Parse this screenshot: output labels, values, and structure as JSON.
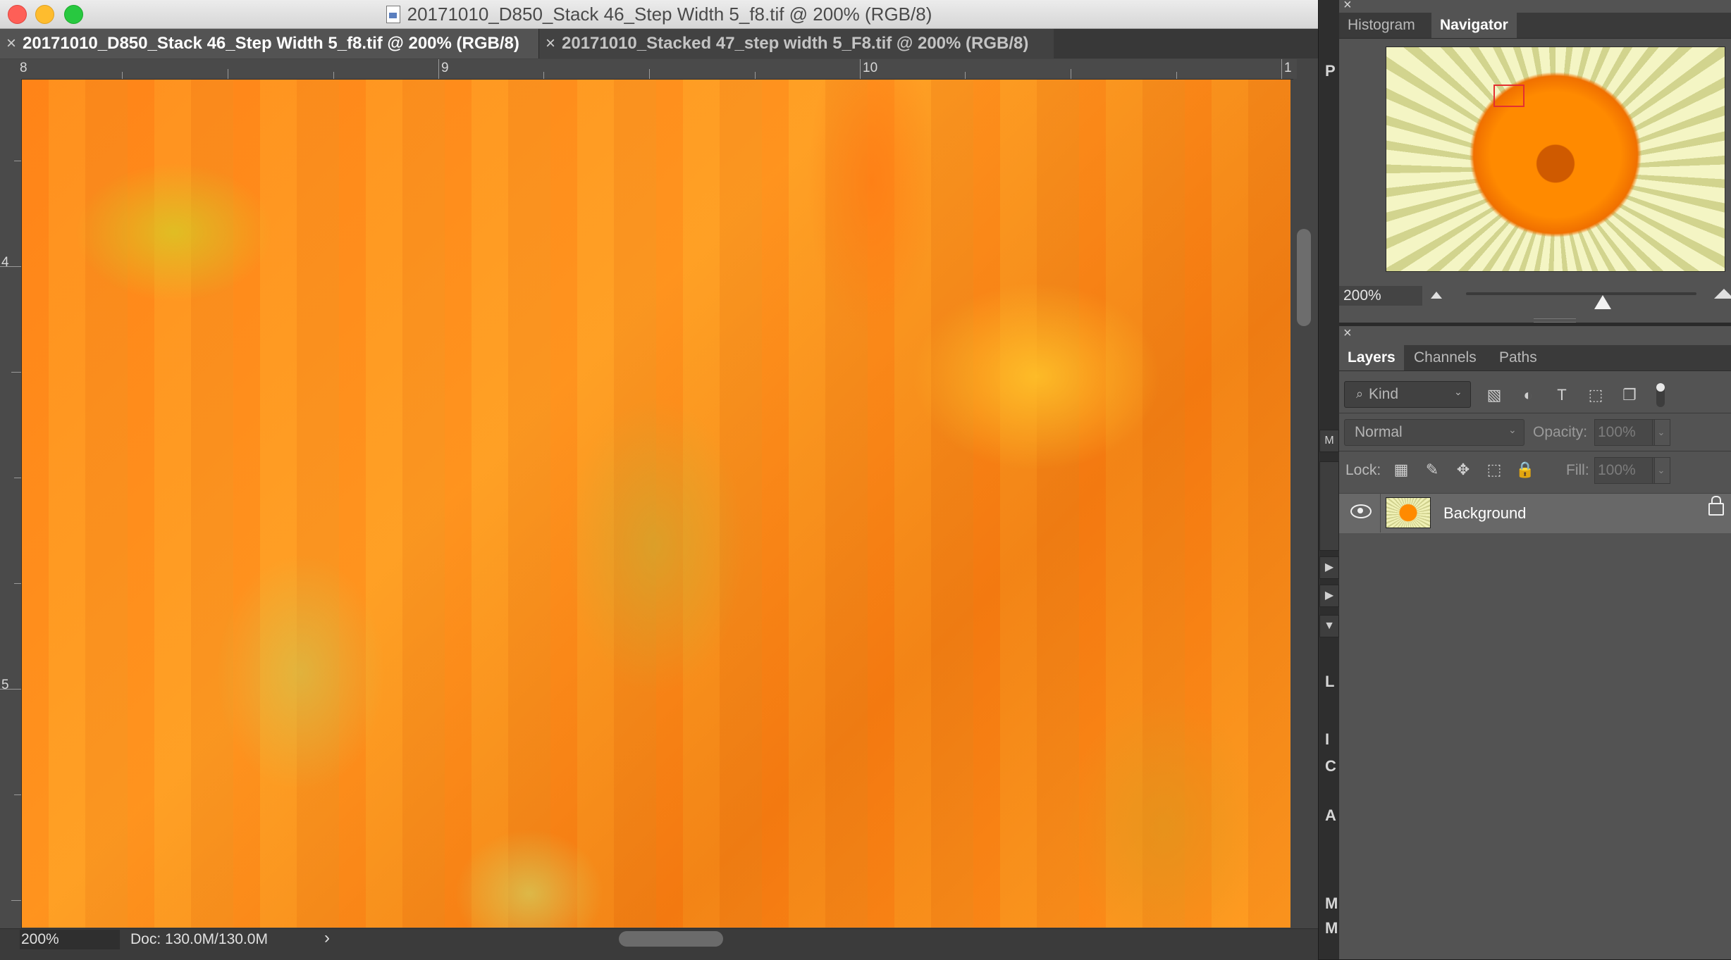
{
  "window": {
    "title": "20171010_D850_Stack 46_Step Width 5_f8.tif @ 200% (RGB/8)"
  },
  "tabs": [
    {
      "close": "×",
      "label": "20171010_D850_Stack 46_Step Width 5_f8.tif @ 200% (RGB/8)",
      "active": true
    },
    {
      "close": "×",
      "label": "20171010_Stacked 47_step width 5_F8.tif @ 200% (RGB/8)",
      "active": false
    }
  ],
  "ruler": {
    "top_labels": [
      "8",
      "9",
      "10",
      "1"
    ],
    "left_labels": [
      "4",
      "5"
    ]
  },
  "status": {
    "zoom": "200%",
    "doc": "Doc: 130.0M/130.0M",
    "arrow": "›"
  },
  "strip": {
    "letters": [
      "P",
      "M",
      "L",
      "I",
      "C",
      "A",
      "A",
      "M",
      "M"
    ]
  },
  "top_panel": {
    "close": "×",
    "tabs": [
      {
        "label": "Histogram",
        "active": false
      },
      {
        "label": "Navigator",
        "active": true
      }
    ],
    "zoom": "200%",
    "zoom_slider_fraction": 0.57
  },
  "layers_panel": {
    "close": "×",
    "tabs": [
      {
        "label": "Layers",
        "active": true
      },
      {
        "label": "Channels",
        "active": false
      },
      {
        "label": "Paths",
        "active": false
      }
    ],
    "filter": {
      "search_icon": "⌕",
      "kind_label": "Kind",
      "chevron": "⌄",
      "filter_icons": [
        "image-filter-icon",
        "adjustment-filter-icon",
        "type-filter-icon",
        "shape-filter-icon",
        "smart-object-filter-icon"
      ],
      "filter_glyphs": [
        "▧",
        "◐",
        "T",
        "⬚",
        "❐"
      ]
    },
    "blend_mode": "Normal",
    "blend_chevron": "⌄",
    "opacity_label": "Opacity:",
    "opacity_value": "100%",
    "lock_label": "Lock:",
    "lock_glyphs": [
      "▦",
      "✎",
      "✥",
      "⬚",
      "🔒"
    ],
    "fill_label": "Fill:",
    "fill_value": "100%",
    "layers": [
      {
        "name": "Background",
        "visible": true,
        "locked": true
      }
    ]
  }
}
